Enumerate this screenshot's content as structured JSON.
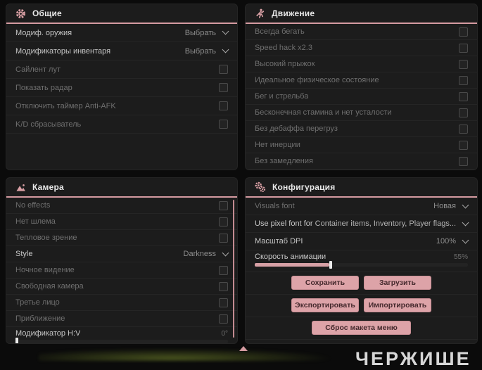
{
  "accent_color": "#d59ba1",
  "button_color": "#dda3a8",
  "panel_bg": "#1c1c1c",
  "panels": {
    "general": {
      "title": "Общие",
      "icon": "gear-icon",
      "rows": [
        {
          "label": "Модиф. оружия",
          "type": "dropdown",
          "value": "Выбрать"
        },
        {
          "label": "Модификаторы инвентаря",
          "type": "dropdown",
          "value": "Выбрать"
        },
        {
          "label": "Сайлент лут",
          "type": "checkbox",
          "checked": false
        },
        {
          "label": "Показать радар",
          "type": "checkbox",
          "checked": false
        },
        {
          "label": "Отключить таймер Anti-AFK",
          "type": "checkbox",
          "checked": false
        },
        {
          "label": "K/D сбрасыватель",
          "type": "checkbox",
          "checked": false
        }
      ]
    },
    "movement": {
      "title": "Движение",
      "icon": "runner-icon",
      "rows": [
        {
          "label": "Всегда бегать",
          "type": "checkbox",
          "checked": false
        },
        {
          "label": "Speed hack x2.3",
          "type": "checkbox",
          "checked": false
        },
        {
          "label": "Высокий прыжок",
          "type": "checkbox",
          "checked": false
        },
        {
          "label": "Идеальное физическое состояние",
          "type": "checkbox",
          "checked": false
        },
        {
          "label": "Бег и стрельба",
          "type": "checkbox",
          "checked": false
        },
        {
          "label": "Бесконечная стамина и нет усталости",
          "type": "checkbox",
          "checked": false
        },
        {
          "label": "Без дебаффа перегруз",
          "type": "checkbox",
          "checked": false
        },
        {
          "label": "Нет инерции",
          "type": "checkbox",
          "checked": false
        },
        {
          "label": "Без замедления",
          "type": "checkbox",
          "checked": false
        }
      ]
    },
    "camera": {
      "title": "Камера",
      "icon": "image-icon",
      "rows": [
        {
          "label": "No effects",
          "type": "checkbox",
          "checked": false
        },
        {
          "label": "Нет шлема",
          "type": "checkbox",
          "checked": false
        },
        {
          "label": "Тепловое зрение",
          "type": "checkbox",
          "checked": false
        },
        {
          "label": "Style",
          "type": "dropdown",
          "value": "Darkness"
        },
        {
          "label": "Ночное видение",
          "type": "checkbox",
          "checked": false
        },
        {
          "label": "Свободная камера",
          "type": "checkbox",
          "checked": false
        },
        {
          "label": "Третье лицо",
          "type": "checkbox",
          "checked": false
        },
        {
          "label": "Приближение",
          "type": "checkbox",
          "checked": false
        },
        {
          "label": "Модификатор H:V",
          "type": "slider",
          "value": "0°",
          "fill_percent": 0
        }
      ]
    },
    "config": {
      "title": "Конфигурация",
      "icon": "gears-icon",
      "rows": [
        {
          "label": "Visuals font",
          "type": "dropdown",
          "value": "Новая"
        },
        {
          "label": "Use pixel font for",
          "type": "dropdown",
          "value": "Container items, Inventory, Player flags..."
        },
        {
          "label": "Масштаб DPI",
          "type": "dropdown",
          "value": "100%"
        },
        {
          "label": "Скорость анимации",
          "type": "slider",
          "value": "55%",
          "fill_percent": 35
        }
      ],
      "buttons": [
        {
          "label": "Сохранить"
        },
        {
          "label": "Загрузить"
        },
        {
          "label": "Экспортировать"
        },
        {
          "label": "Импортировать"
        },
        {
          "label": "Сброс макета меню"
        }
      ]
    }
  },
  "watermark": "ЧЕРЖИШЕ"
}
